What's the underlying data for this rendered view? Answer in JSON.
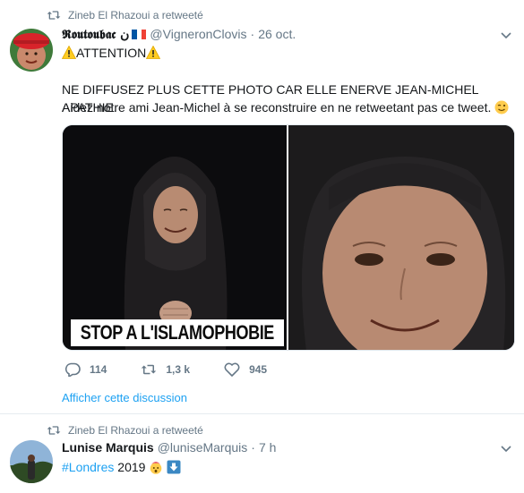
{
  "tweets": [
    {
      "retweet_label": "Zineb El Rhazoui a retweeté",
      "author_name": "𝕽𝖔𝖚𝖙𝖔𝖚𝖇𝖆𝖈 ن",
      "handle": "@VigneronClovis",
      "separator": "·",
      "time": "26 oct.",
      "line1": "ATTENTION",
      "line2": "NE DIFFUSEZ PLUS CETTE PHOTO CAR ELLE ENERVE JEAN-MICHEL APATHIE.",
      "line3": "Aidez notre ami Jean-Michel à se reconstruire en ne retweetant pas ce tweet.",
      "media_banner": "STOP A L'ISLAMOPHOBIE",
      "replies": "114",
      "retweets": "1,3 k",
      "likes": "945",
      "show_thread": "Afficher cette discussion"
    },
    {
      "retweet_label": "Zineb El Rhazoui a retweeté",
      "author_name": "Lunise Marquis",
      "handle": "@luniseMarquis",
      "separator": "·",
      "time": "7 h",
      "hashtag": "#Londres",
      "text_after": "2019"
    }
  ],
  "icons": {
    "retweet": "retweet-icon",
    "reply": "reply-icon",
    "like": "heart-icon",
    "caret": "chevron-down-icon",
    "warning": "warning-icon",
    "wink": "winking-face-icon",
    "shocked": "exploding-head-icon",
    "arrow": "down-arrow-icon",
    "flag": "french-flag-icon"
  },
  "colors": {
    "accent": "#1da1f2",
    "secondary_text": "#657786",
    "primary_text": "#14171a",
    "divider": "#e6ecf0"
  }
}
